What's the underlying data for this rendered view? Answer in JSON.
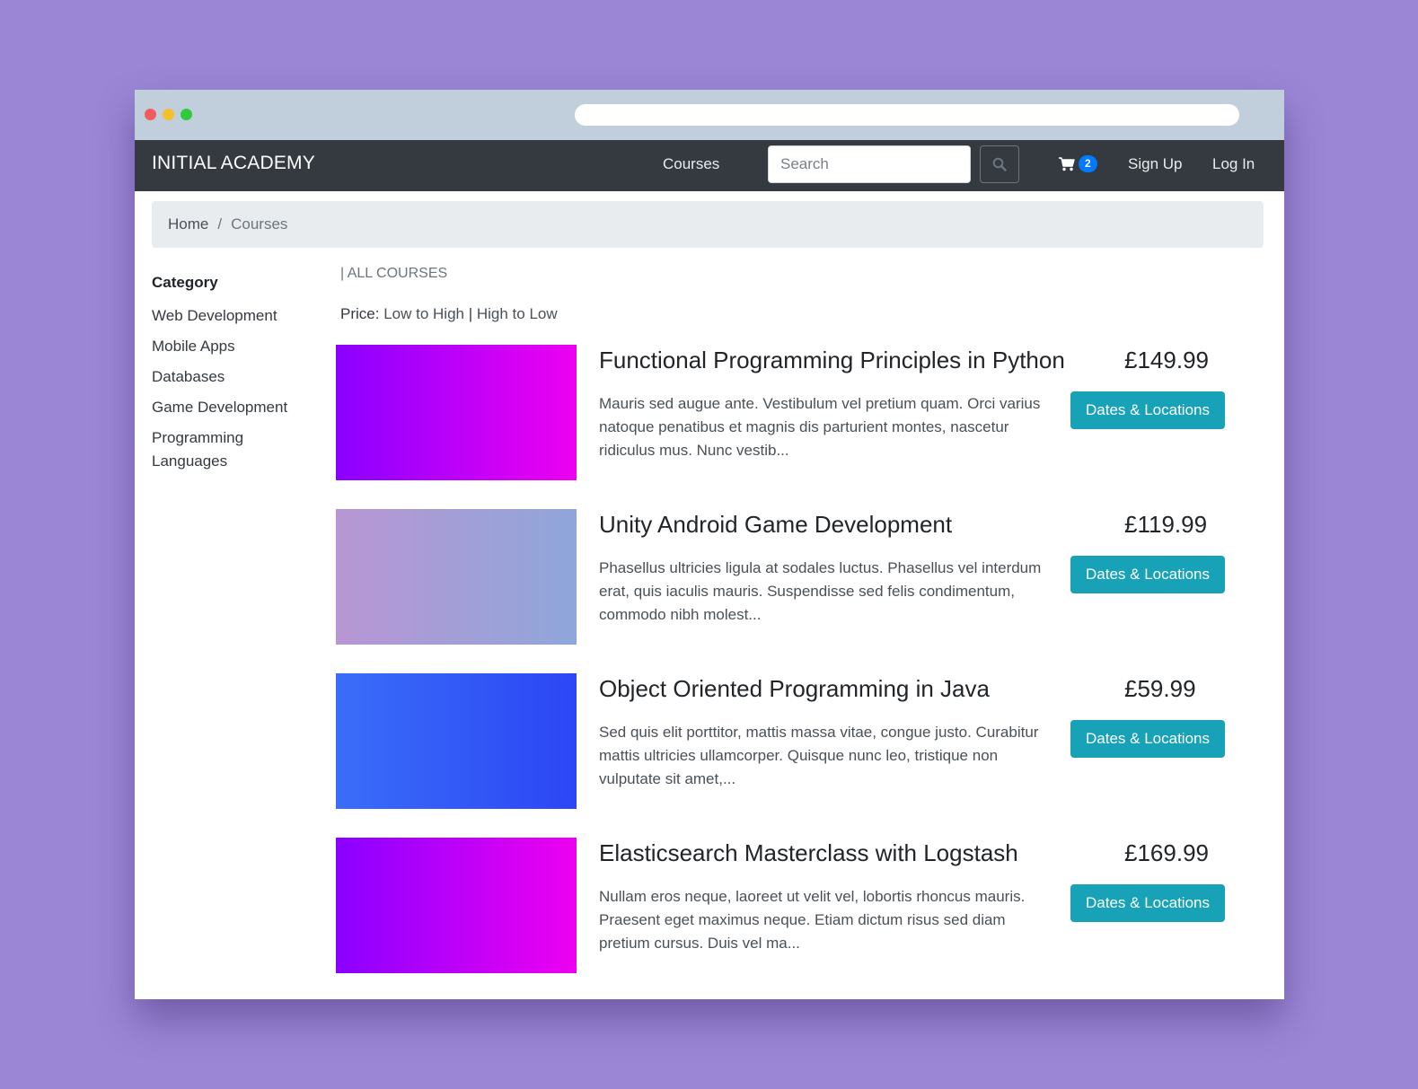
{
  "browser": {
    "url": ""
  },
  "navbar": {
    "brand": "INITIAL ACADEMY",
    "courses_link": "Courses",
    "search_placeholder": "Search",
    "cart_count": "2",
    "signup": "Sign Up",
    "login": "Log In"
  },
  "breadcrumb": {
    "home": "Home",
    "separator": "/",
    "current": "Courses"
  },
  "sidebar": {
    "heading": "Category",
    "categories": [
      "Web Development",
      "Mobile Apps",
      "Databases",
      "Game Development",
      "Programming Languages"
    ]
  },
  "main": {
    "section_title": "| ALL COURSES",
    "sort_label": "Price:",
    "sort_low_high": "Low to High",
    "sort_divider": "|",
    "sort_high_low": "High to Low"
  },
  "courses": [
    {
      "title": "Functional Programming Principles in Python",
      "price": "£149.99",
      "description": "Mauris sed augue ante. Vestibulum vel pretium quam. Orci varius natoque penatibus et magnis dis parturient montes, nascetur ridiculus mus. Nunc vestib...",
      "button": "Dates & Locations",
      "gradient": [
        "#8a00ff",
        "#ee00f0"
      ]
    },
    {
      "title": "Unity Android Game Development",
      "price": "£119.99",
      "description": "Phasellus ultricies ligula at sodales luctus. Phasellus vel interdum erat, quis iaculis mauris. Suspendisse sed felis condimentum, commodo nibh molest...",
      "button": "Dates & Locations",
      "gradient": [
        "#b896d4",
        "#8fa6da"
      ]
    },
    {
      "title": "Object Oriented Programming in Java",
      "price": "£59.99",
      "description": "Sed quis elit porttitor, mattis massa vitae, congue justo. Curabitur mattis ultricies ullamcorper. Quisque nunc leo, tristique non vulputate sit amet,...",
      "button": "Dates & Locations",
      "gradient": [
        "#3a6df8",
        "#2c46f5"
      ]
    },
    {
      "title": "Elasticsearch Masterclass with Logstash",
      "price": "£169.99",
      "description": "Nullam eros neque, laoreet ut velit vel, lobortis rhoncus mauris. Praesent eget maximus neque. Etiam dictum risus sed diam pretium cursus. Duis vel ma...",
      "button": "Dates & Locations",
      "gradient": [
        "#8a00ff",
        "#ee00f0"
      ]
    }
  ],
  "colors": {
    "background": "#9b86d6",
    "navbar": "#343a40",
    "button": "#17a2b8",
    "badge": "#007bff"
  },
  "icons": {
    "search": "search-icon",
    "cart": "cart-icon"
  }
}
